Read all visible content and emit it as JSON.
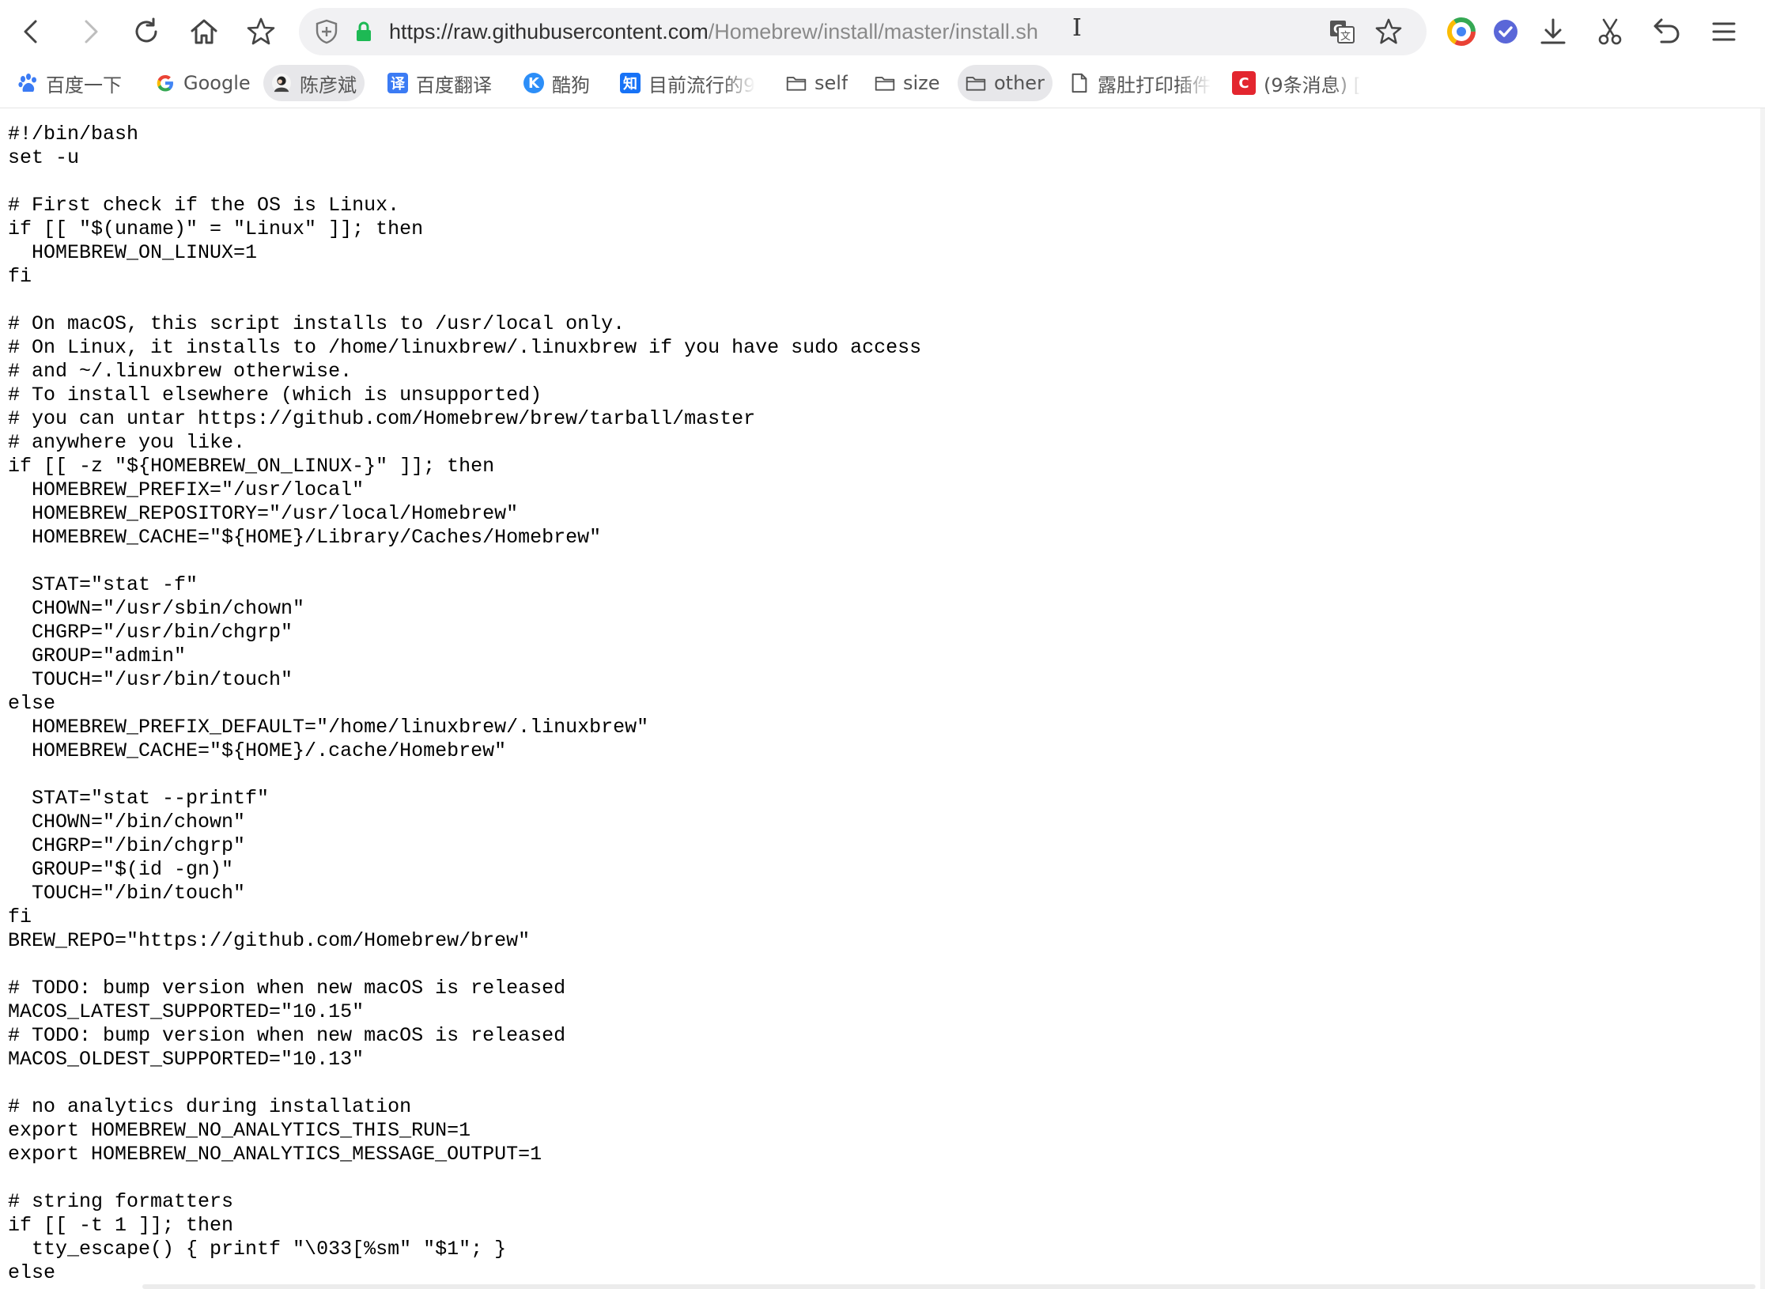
{
  "browser": {
    "url_host": "https://raw.githubusercontent.com",
    "url_path": "/Homebrew/install/master/install.sh"
  },
  "bookmarks": [
    {
      "label": "百度一下",
      "icon": "baidu-paw-icon"
    },
    {
      "label": "Google",
      "icon": "google-icon"
    },
    {
      "label": "陈彦斌",
      "icon": "avatar-icon"
    },
    {
      "label": "百度翻译",
      "icon": "baidu-translate-icon"
    },
    {
      "label": "酷狗",
      "icon": "kugou-icon"
    },
    {
      "label": "目前流行的9",
      "icon": "zhihu-icon"
    },
    {
      "label": "self",
      "icon": "folder-icon"
    },
    {
      "label": "size",
      "icon": "folder-icon"
    },
    {
      "label": "other",
      "icon": "folder-icon"
    },
    {
      "label": "露肚打印插件",
      "icon": "page-icon"
    },
    {
      "label": "(9条消息) [",
      "icon": "csdn-icon"
    }
  ],
  "code_lines": [
    "#!/bin/bash",
    "set -u",
    "",
    "# First check if the OS is Linux.",
    "if [[ \"$(uname)\" = \"Linux\" ]]; then",
    "  HOMEBREW_ON_LINUX=1",
    "fi",
    "",
    "# On macOS, this script installs to /usr/local only.",
    "# On Linux, it installs to /home/linuxbrew/.linuxbrew if you have sudo access",
    "# and ~/.linuxbrew otherwise.",
    "# To install elsewhere (which is unsupported)",
    "# you can untar https://github.com/Homebrew/brew/tarball/master",
    "# anywhere you like.",
    "if [[ -z \"${HOMEBREW_ON_LINUX-}\" ]]; then",
    "  HOMEBREW_PREFIX=\"/usr/local\"",
    "  HOMEBREW_REPOSITORY=\"/usr/local/Homebrew\"",
    "  HOMEBREW_CACHE=\"${HOME}/Library/Caches/Homebrew\"",
    "",
    "  STAT=\"stat -f\"",
    "  CHOWN=\"/usr/sbin/chown\"",
    "  CHGRP=\"/usr/bin/chgrp\"",
    "  GROUP=\"admin\"",
    "  TOUCH=\"/usr/bin/touch\"",
    "else",
    "  HOMEBREW_PREFIX_DEFAULT=\"/home/linuxbrew/.linuxbrew\"",
    "  HOMEBREW_CACHE=\"${HOME}/.cache/Homebrew\"",
    "",
    "  STAT=\"stat --printf\"",
    "  CHOWN=\"/bin/chown\"",
    "  CHGRP=\"/bin/chgrp\"",
    "  GROUP=\"$(id -gn)\"",
    "  TOUCH=\"/bin/touch\"",
    "fi",
    "BREW_REPO=\"https://github.com/Homebrew/brew\"",
    "",
    "# TODO: bump version when new macOS is released",
    "MACOS_LATEST_SUPPORTED=\"10.15\"",
    "# TODO: bump version when new macOS is released",
    "MACOS_OLDEST_SUPPORTED=\"10.13\"",
    "",
    "# no analytics during installation",
    "export HOMEBREW_NO_ANALYTICS_THIS_RUN=1",
    "export HOMEBREW_NO_ANALYTICS_MESSAGE_OUTPUT=1",
    "",
    "# string formatters",
    "if [[ -t 1 ]]; then",
    "  tty_escape() { printf \"\\033[%sm\" \"$1\"; }",
    "else"
  ]
}
